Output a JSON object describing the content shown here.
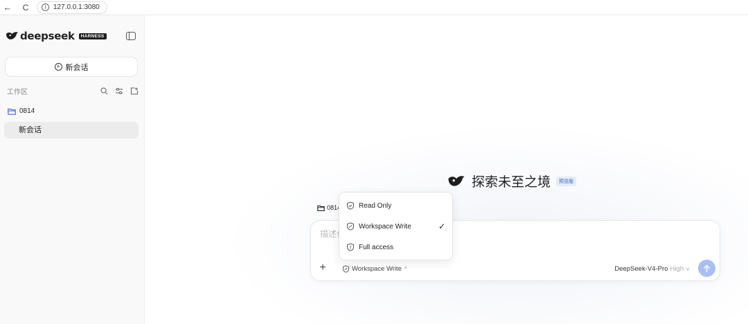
{
  "browser": {
    "back_glyph": "←",
    "reload_glyph": "C",
    "url": "127.0.0.1:3080"
  },
  "sidebar": {
    "logo_text": "deepseek",
    "logo_badge": "HARNESS",
    "new_chat_label": "新会话",
    "workspace_title": "工作区",
    "icons": [
      "search-icon",
      "filter-icon",
      "new-folder-icon"
    ],
    "folder_name": "0814",
    "sessions": [
      {
        "label": "新会话",
        "selected": true
      }
    ]
  },
  "main": {
    "hero_title": "探索未至之境",
    "hero_badge": "预览版",
    "workspace_chip": "0814",
    "input_placeholder": "描述任务…",
    "add_glyph": "+",
    "mode_label": "Workspace Write",
    "mode_caret": "^",
    "model_name": "DeepSeek-V4-Pro",
    "model_level": "High",
    "model_caret": "v",
    "accent_color": "#a9bff3"
  },
  "mode_menu": {
    "items": [
      {
        "label": "Read Only",
        "icon": "shield-icon",
        "selected": false
      },
      {
        "label": "Workspace Write",
        "icon": "shield-edit-icon",
        "selected": true
      },
      {
        "label": "Full access",
        "icon": "shield-alert-icon",
        "selected": false
      }
    ],
    "check_glyph": "✓"
  }
}
